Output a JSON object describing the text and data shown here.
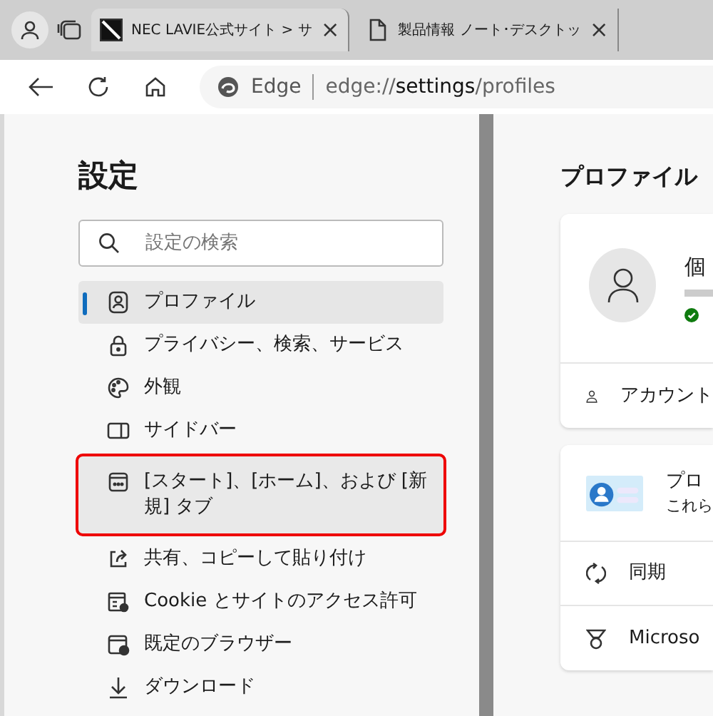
{
  "tabs": [
    {
      "title": "NEC LAVIE公式サイト > サ",
      "close": "×",
      "selected": true
    },
    {
      "title": "製品情報 ノート･デスクトッ",
      "close": "×",
      "selected": false
    }
  ],
  "address_bar": {
    "site_label": "Edge",
    "url_prefix": "edge://",
    "url_host": "settings",
    "url_path": "/profiles"
  },
  "sidebar": {
    "title": "設定",
    "search": {
      "placeholder": "設定の検索"
    },
    "items": [
      {
        "label": "プロファイル",
        "selected": true,
        "highlighted": false
      },
      {
        "label": "プライバシー、検索、サービス",
        "selected": false,
        "highlighted": false
      },
      {
        "label": "外観",
        "selected": false,
        "highlighted": false
      },
      {
        "label": "サイドバー",
        "selected": false,
        "highlighted": false
      },
      {
        "label": "[スタート]、[ホーム]、および [新規] タブ",
        "selected": false,
        "highlighted": true
      },
      {
        "label": "共有、コピーして貼り付け",
        "selected": false,
        "highlighted": false
      },
      {
        "label": "Cookie とサイトのアクセス許可",
        "selected": false,
        "highlighted": false
      },
      {
        "label": "既定のブラウザー",
        "selected": false,
        "highlighted": false
      },
      {
        "label": "ダウンロード",
        "selected": false,
        "highlighted": false
      }
    ]
  },
  "main": {
    "title": "プロファイル",
    "profile_card": {
      "name": "個",
      "account_row": "アカウント"
    },
    "rows": [
      {
        "kind": "promo",
        "title": "プロ",
        "text": "これら"
      },
      {
        "kind": "sync",
        "label": "同期"
      },
      {
        "kind": "rewards",
        "label": "Microso"
      }
    ]
  }
}
